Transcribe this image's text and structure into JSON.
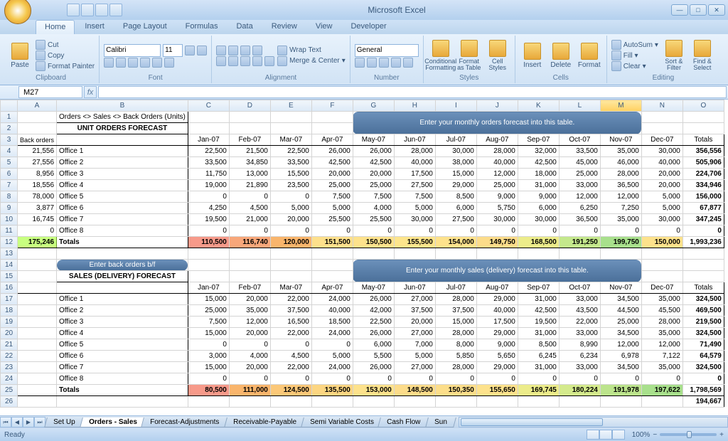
{
  "app_title": "Microsoft Excel",
  "ribbon_tabs": [
    "Home",
    "Insert",
    "Page Layout",
    "Formulas",
    "Data",
    "Review",
    "View",
    "Developer"
  ],
  "active_tab": 0,
  "ribbon": {
    "clipboard": {
      "label": "Clipboard",
      "paste": "Paste",
      "cut": "Cut",
      "copy": "Copy",
      "painter": "Format Painter"
    },
    "font": {
      "label": "Font",
      "family": "Calibri",
      "size": "11"
    },
    "alignment": {
      "label": "Alignment",
      "wrap": "Wrap Text",
      "merge": "Merge & Center"
    },
    "number": {
      "label": "Number",
      "format": "General"
    },
    "styles": {
      "label": "Styles",
      "cond": "Conditional Formatting",
      "table": "Format as Table",
      "cell": "Cell Styles"
    },
    "cells": {
      "label": "Cells",
      "insert": "Insert",
      "delete": "Delete",
      "format": "Format"
    },
    "editing": {
      "label": "Editing",
      "sum": "AutoSum",
      "fill": "Fill",
      "clear": "Clear",
      "sort": "Sort & Filter",
      "find": "Find & Select"
    }
  },
  "name_box": "M27",
  "formula": "",
  "columns": [
    "A",
    "B",
    "C",
    "D",
    "E",
    "F",
    "G",
    "H",
    "I",
    "J",
    "K",
    "L",
    "M",
    "N",
    "O"
  ],
  "highlight_col": "M",
  "breadcrumb": "Orders <> Sales <> Back Orders (Units)",
  "section1_title": "UNIT ORDERS FORECAST",
  "banner1": "Enter your monthly orders forecast into this table.",
  "back_orders_label": "Back orders",
  "back_btn": "Enter back orders b/f",
  "months": [
    "Jan-07",
    "Feb-07",
    "Mar-07",
    "Apr-07",
    "May-07",
    "Jun-07",
    "Jul-07",
    "Aug-07",
    "Sep-07",
    "Oct-07",
    "Nov-07",
    "Dec-07"
  ],
  "totals_label": "Totals",
  "orders_back": [
    "21,556",
    "27,556",
    "8,956",
    "18,556",
    "78,000",
    "3,877",
    "16,745",
    "0"
  ],
  "orders_back_total": "175,246",
  "offices": [
    "Office 1",
    "Office 2",
    "Office 3",
    "Office 4",
    "Office 5",
    "Office 6",
    "Office 7",
    "Office 8"
  ],
  "orders": [
    [
      "22,500",
      "21,500",
      "22,500",
      "26,000",
      "26,000",
      "28,000",
      "30,000",
      "28,000",
      "32,000",
      "33,500",
      "35,000",
      "30,000",
      "356,556"
    ],
    [
      "33,500",
      "34,850",
      "33,500",
      "42,500",
      "42,500",
      "40,000",
      "38,000",
      "40,000",
      "42,500",
      "45,000",
      "46,000",
      "40,000",
      "505,906"
    ],
    [
      "11,750",
      "13,000",
      "15,500",
      "20,000",
      "20,000",
      "17,500",
      "15,000",
      "12,000",
      "18,000",
      "25,000",
      "28,000",
      "20,000",
      "224,706"
    ],
    [
      "19,000",
      "21,890",
      "23,500",
      "25,000",
      "25,000",
      "27,500",
      "29,000",
      "25,000",
      "31,000",
      "33,000",
      "36,500",
      "20,000",
      "334,946"
    ],
    [
      "0",
      "0",
      "0",
      "7,500",
      "7,500",
      "7,500",
      "8,500",
      "9,000",
      "9,000",
      "12,000",
      "12,000",
      "5,000",
      "156,000"
    ],
    [
      "4,250",
      "4,500",
      "5,000",
      "5,000",
      "4,000",
      "5,000",
      "6,000",
      "5,750",
      "6,000",
      "6,250",
      "7,250",
      "5,000",
      "67,877"
    ],
    [
      "19,500",
      "21,000",
      "20,000",
      "25,500",
      "25,500",
      "30,000",
      "27,500",
      "30,000",
      "30,000",
      "36,500",
      "35,000",
      "30,000",
      "347,245"
    ],
    [
      "0",
      "0",
      "0",
      "0",
      "0",
      "0",
      "0",
      "0",
      "0",
      "0",
      "0",
      "0",
      "0"
    ]
  ],
  "orders_totals": [
    "110,500",
    "116,740",
    "120,000",
    "151,500",
    "150,500",
    "155,500",
    "154,000",
    "149,750",
    "168,500",
    "191,250",
    "199,750",
    "150,000",
    "1,993,236"
  ],
  "orders_colors": [
    "#f79a8a",
    "#f8a77a",
    "#f9b56c",
    "#fde08c",
    "#fde28c",
    "#fde58c",
    "#fde28c",
    "#fcdc8a",
    "#ecec8a",
    "#c4e88c",
    "#a8e08c",
    "#fde28c",
    "#ffffff"
  ],
  "section2_title": "SALES (DELIVERY) FORECAST",
  "banner2": "Enter your monthly sales (delivery) forecast into this table.",
  "sales": [
    [
      "15,000",
      "20,000",
      "22,000",
      "24,000",
      "26,000",
      "27,000",
      "28,000",
      "29,000",
      "31,000",
      "33,000",
      "34,500",
      "35,000",
      "324,500"
    ],
    [
      "25,000",
      "35,000",
      "37,500",
      "40,000",
      "42,000",
      "37,500",
      "37,500",
      "40,000",
      "42,500",
      "43,500",
      "44,500",
      "45,500",
      "469,500"
    ],
    [
      "7,500",
      "12,000",
      "16,500",
      "18,500",
      "22,500",
      "20,000",
      "15,000",
      "17,500",
      "19,500",
      "22,000",
      "25,000",
      "28,000",
      "219,500"
    ],
    [
      "15,000",
      "20,000",
      "22,000",
      "24,000",
      "26,000",
      "27,000",
      "28,000",
      "29,000",
      "31,000",
      "33,000",
      "34,500",
      "35,000",
      "324,500"
    ],
    [
      "0",
      "0",
      "0",
      "0",
      "6,000",
      "7,000",
      "8,000",
      "9,000",
      "8,500",
      "8,990",
      "12,000",
      "12,000",
      "71,490"
    ],
    [
      "3,000",
      "4,000",
      "4,500",
      "5,000",
      "5,500",
      "5,000",
      "5,850",
      "5,650",
      "6,245",
      "6,234",
      "6,978",
      "7,122",
      "64,579"
    ],
    [
      "15,000",
      "20,000",
      "22,000",
      "24,000",
      "26,000",
      "27,000",
      "28,000",
      "29,000",
      "31,000",
      "33,000",
      "34,500",
      "35,000",
      "324,500"
    ],
    [
      "0",
      "0",
      "0",
      "0",
      "0",
      "0",
      "0",
      "0",
      "0",
      "0",
      "0",
      "0",
      "0"
    ]
  ],
  "sales_totals": [
    "80,500",
    "111,000",
    "124,500",
    "135,500",
    "153,000",
    "148,500",
    "150,350",
    "155,650",
    "169,745",
    "180,224",
    "191,978",
    "197,622",
    "1,798,569"
  ],
  "sales_extra": "194,667",
  "sales_colors": [
    "#f79a8a",
    "#f9b56c",
    "#fbc878",
    "#fcd682",
    "#fde28c",
    "#fcdc8a",
    "#fcde8a",
    "#fde28c",
    "#ecec8a",
    "#d4ea8c",
    "#bce48c",
    "#a8e08c",
    "#ffffff"
  ],
  "sheet_tabs": [
    "Set Up",
    "Orders - Sales",
    "Forecast-Adjustments",
    "Receivable-Payable",
    "Semi Variable Costs",
    "Cash Flow",
    "Sun"
  ],
  "active_sheet": 1,
  "status": "Ready",
  "zoom": "100%"
}
